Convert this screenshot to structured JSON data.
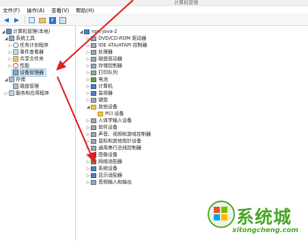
{
  "window": {
    "title": "计算机管理"
  },
  "menu": [
    "文件(F)",
    "操作(A)",
    "查看(V)",
    "帮助(H)"
  ],
  "toolbar": {
    "icons": [
      "back-icon",
      "forward-icon",
      "show-hide-console-tree-icon",
      "folder-icon",
      "help-icon",
      "properties-icon"
    ]
  },
  "tree": {
    "root": "计算机管理(本地)",
    "system_tools": "系统工具",
    "task_scheduler": "任务计划程序",
    "event_viewer": "事件查看器",
    "shared_folders": "共享文件夹",
    "performance": "性能",
    "device_manager": "设备管理器",
    "storage": "存储",
    "disk_management": "磁盘管理",
    "services_apps": "服务和应用程序"
  },
  "devices": {
    "computer_name": "rqst-java-2",
    "items": [
      "DVD/CD-ROM 驱动器",
      "IDE ATA/ATAPI 控制器",
      "处理器",
      "磁盘驱动器",
      "存储控制器",
      "打印队列",
      "电池",
      "计算机",
      "监视器",
      "键盘",
      "其他设备",
      "PCI 设备",
      "人体学输入设备",
      "软件设备",
      "声音、视频和游戏控制器",
      "鼠标和其他指针设备",
      "通用串行总线控制器",
      "图像设备",
      "网络适配器",
      "系统设备",
      "显示适配器",
      "音频输入和输出"
    ]
  },
  "watermark": {
    "brand": "系统城",
    "url": "xitongcheng.com"
  },
  "colors": {
    "selection": "#cce4f7",
    "arrow": "#e02020",
    "watermark": "#4aa526"
  }
}
